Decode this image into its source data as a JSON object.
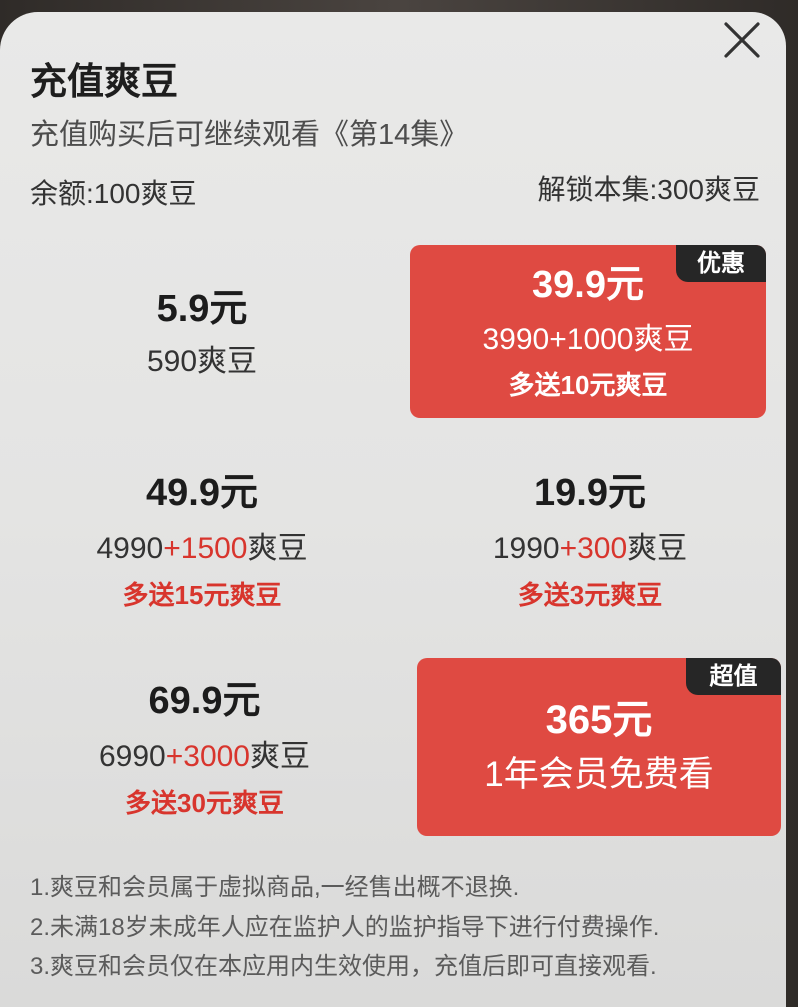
{
  "dialog": {
    "title": "充值爽豆",
    "subtitle": "充值购买后可继续观看《第14集》",
    "balance": "余额:100爽豆",
    "unlock_cost": "解锁本集:300爽豆",
    "close_icon": "close-icon"
  },
  "options": [
    {
      "price": "5.9元",
      "amount_base": "590",
      "amount_unit": "爽豆",
      "highlighted": false
    },
    {
      "price": "39.9元",
      "amount_base": "3990",
      "amount_bonus": "+1000",
      "amount_unit": "爽豆",
      "extra": "多送10元爽豆",
      "badge": "优惠",
      "highlighted": true
    },
    {
      "price": "49.9元",
      "amount_base": "4990",
      "amount_bonus": "+1500",
      "amount_unit": "爽豆",
      "extra": "多送15元爽豆",
      "highlighted": false
    },
    {
      "price": "19.9元",
      "amount_base": "1990",
      "amount_bonus": "+300",
      "amount_unit": "爽豆",
      "extra": "多送3元爽豆",
      "highlighted": false
    },
    {
      "price": "69.9元",
      "amount_base": "6990",
      "amount_bonus": "+3000",
      "amount_unit": "爽豆",
      "extra": "多送30元爽豆",
      "highlighted": false
    },
    {
      "price": "365元",
      "description": "1年会员免费看",
      "badge": "超值",
      "highlighted": true
    }
  ],
  "notes": [
    "1.爽豆和会员属于虚拟商品,一经售出概不退换.",
    "2.未满18岁未成年人应在监护人的监护指导下进行付费操作.",
    "3.爽豆和会员仅在本应用内生效使用，充值后即可直接观看."
  ],
  "colors": {
    "accent_red": "#df4a42",
    "badge_dark": "#262626",
    "bonus_red": "#d8352d"
  }
}
